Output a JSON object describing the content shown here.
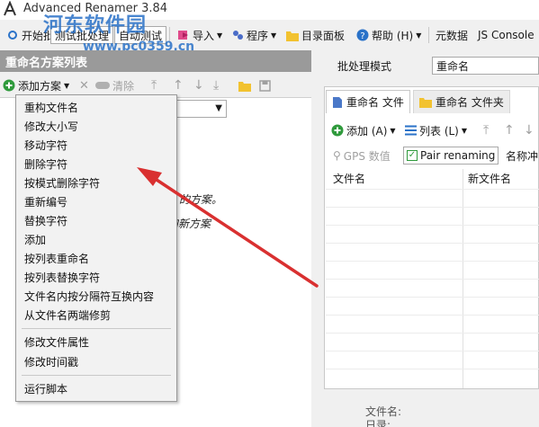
{
  "window": {
    "title": "Advanced Renamer 3.84"
  },
  "watermark": {
    "text": "河东软件园",
    "url": "www.pc0359.cn"
  },
  "toolbar": {
    "items": [
      {
        "label": "开始批处理"
      },
      {
        "label": "测试批处理"
      },
      {
        "label": "自动测试"
      },
      {
        "label": "导入"
      },
      {
        "label": "程序"
      },
      {
        "label": "目录面板"
      },
      {
        "label": "帮助 (H)"
      },
      {
        "label": "元数据"
      },
      {
        "label": "JS Console"
      }
    ]
  },
  "left_panel": {
    "title": "重命名方案列表",
    "add_method_label": "添加方案",
    "clear_label": "清除",
    "hint_line1": "的方案。",
    "hint_line2": "加新方案"
  },
  "method_menu": {
    "group1": [
      "重构文件名",
      "修改大小写",
      "移动字符",
      "删除字符",
      "按模式删除字符",
      "重新编号",
      "替换字符",
      "添加",
      "按列表重命名",
      "按列表替换字符",
      "文件名内按分隔符互换内容",
      "从文件名两端修剪"
    ],
    "group2": [
      "修改文件属性",
      "修改时间戳"
    ],
    "group3": [
      "运行脚本"
    ]
  },
  "right_panel": {
    "mode_label": "批处理模式",
    "mode_value": "重命名",
    "tabs": [
      {
        "label": "重命名 文件"
      },
      {
        "label": "重命名 文件夹"
      }
    ],
    "add_label": "添加 (A)",
    "list_label": "列表 (L)",
    "gps_label": "GPS 数值",
    "pair_label": "Pair renaming",
    "name_conflict_label": "名称冲",
    "columns": [
      "文件名",
      "新文件名"
    ],
    "footer_field1": "文件名:",
    "footer_field2": "日录:"
  },
  "colors": {
    "accent_blue": "#2a72c8",
    "panel_header": "#9a9a9a",
    "arrow_red": "#d93030",
    "add_green": "#2f9a3c",
    "folder_yellow": "#f2c230"
  }
}
